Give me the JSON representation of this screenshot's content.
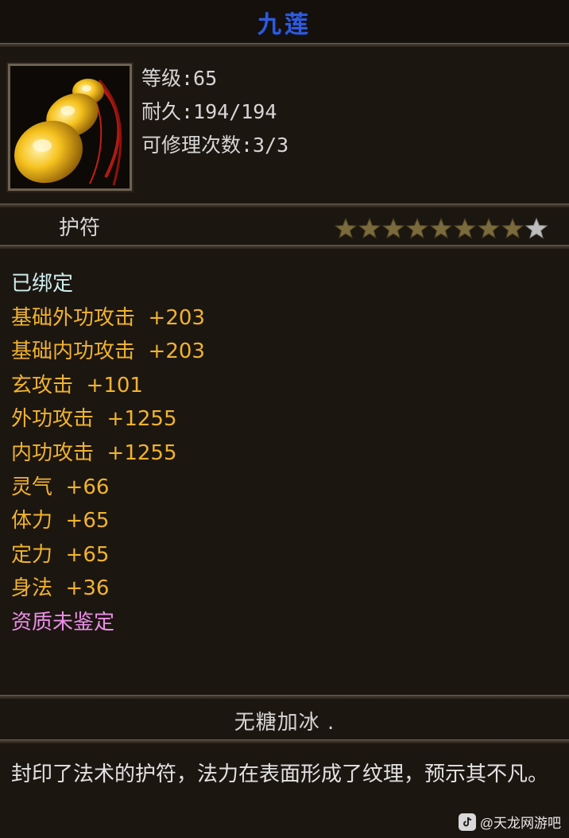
{
  "item": {
    "title": "九莲",
    "icon": "gourd-amulet-icon",
    "level_text": "等级:65",
    "durability_text": "耐久:194/194",
    "repairs_text": "可修理次数:3/3",
    "type_label": "护符",
    "stars": {
      "filled": 8,
      "total": 9
    },
    "bound_text": "已绑定",
    "attributes": [
      {
        "label": "基础外功攻击",
        "value": "+203"
      },
      {
        "label": "基础内功攻击",
        "value": "+203"
      },
      {
        "label": "玄攻击",
        "value": "+101"
      },
      {
        "label": "外功攻击",
        "value": "+1255"
      },
      {
        "label": "内功攻击",
        "value": "+1255"
      },
      {
        "label": "灵气",
        "value": "+66"
      },
      {
        "label": "体力",
        "value": "+65"
      },
      {
        "label": "定力",
        "value": "+65"
      },
      {
        "label": "身法",
        "value": "+36"
      }
    ],
    "quality_text": "资质未鉴定",
    "owner_name": "无糖加冰 .",
    "description": "封印了法术的护符，法力在表面形成了纹理，预示其不凡。"
  },
  "watermark": {
    "text": "@天龙网游吧",
    "icon": "douyin-logo-icon"
  },
  "colors": {
    "title": "#2f5bdc",
    "attribute": "#f0b32e",
    "bound": "#cfeeee",
    "quality": "#ea8fe6",
    "star_filled": "#7a6a3c",
    "star_empty": "#bdbdbd"
  }
}
